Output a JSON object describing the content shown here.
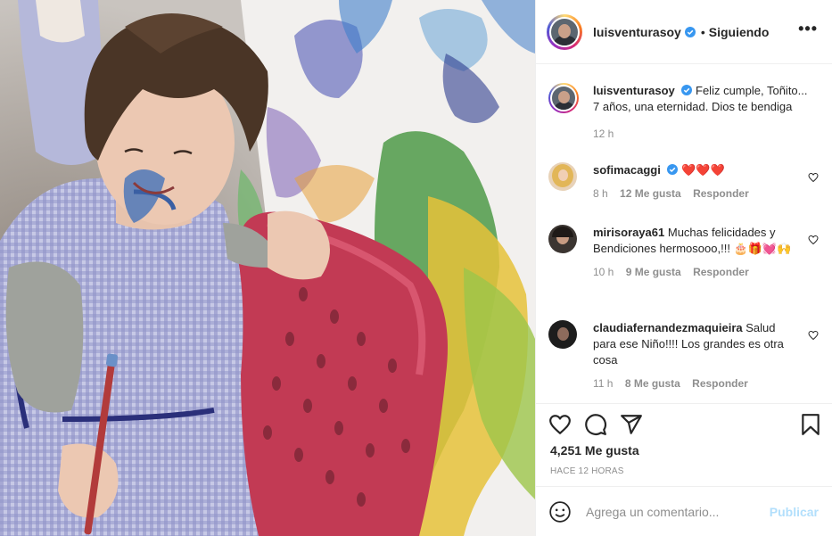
{
  "post": {
    "author": "luisventurasoy",
    "follow_status": "Siguiendo",
    "separator": "•",
    "caption": "Feliz cumple, Toñito... 7 años, una eternidad. Dios te bendiga",
    "caption_time": "12 h"
  },
  "comments": [
    {
      "user": "sofimacaggi",
      "text": "",
      "emoji": "❤️❤️❤️",
      "time": "8 h",
      "likes": "12 Me gusta",
      "reply": "Responder"
    },
    {
      "user": "mirisoraya61",
      "text": "Muchas felicidades y Bendiciones hermosooo,!!! ",
      "emoji": "🎂🎁💓🙌",
      "time": "10 h",
      "likes": "9 Me gusta",
      "reply": "Responder"
    },
    {
      "user": "claudiafernandezmaquieira",
      "text": "Salud para ese Niño!!!! Los grandes es otra cosa",
      "emoji": "",
      "time": "11 h",
      "likes": "8 Me gusta",
      "reply": "Responder"
    }
  ],
  "stats": {
    "likes": "4,251 Me gusta",
    "time_ago": "HACE 12 HORAS"
  },
  "composer": {
    "placeholder": "Agrega un comentario...",
    "publish": "Publicar"
  },
  "icons": [
    "more-icon",
    "verified-icon",
    "heart-icon",
    "comment-icon",
    "share-icon",
    "bookmark-icon",
    "emoji-icon"
  ]
}
